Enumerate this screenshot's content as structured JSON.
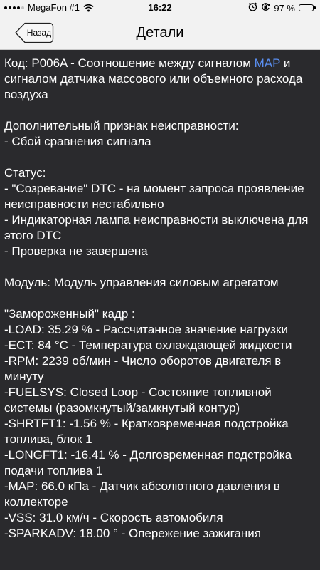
{
  "status_bar": {
    "carrier": "MegaFon #1",
    "time": "16:22",
    "battery_percent": "97 %",
    "battery_level": 0.97,
    "icons": [
      "signal-icon",
      "wifi-icon",
      "alarm-icon",
      "orientation-lock-icon",
      "battery-icon"
    ]
  },
  "nav": {
    "back_label": "Назад",
    "title": "Детали"
  },
  "details": {
    "code_prefix": "Код: P006A - Соотношение между сигналом ",
    "code_link": "MAP",
    "code_suffix": " и сигналом датчика массового или объемного расхода воздуха",
    "extra_heading": "Дополнительный признак неисправности:",
    "extra_item": " - Сбой сравнения сигнала",
    "status_heading": "Статус:",
    "status_item1": " - \"Созревание\" DTC - на момент запроса проявление неисправности нестабильно",
    "status_item2": " - Индикаторная лампа неисправности выключена для этого DTC",
    "status_item3": " - Проверка не завершена",
    "module": "Модуль: Модуль управления силовым агрегатом",
    "freeze_heading": " \"Замороженный\" кадр :",
    "freeze_items": [
      "-LOAD: 35.29 % - Рассчитанное значение нагрузки",
      "-ECT: 84 °C - Температура охлаждающей жидкости",
      "-RPM: 2239 об/мин - Число оборотов двигателя в минуту",
      "-FUELSYS: Closed Loop  - Состояние топливной системы (разомкнутый/замкнутый контур)",
      "-SHRTFT1: -1.56 % - Кратковременная подстройка топлива, блок 1",
      "-LONGFT1: -16.41 % - Долговременная подстройка подачи топлива 1",
      "-MAP: 66.0 кПа - Датчик абсолютного давления в коллекторе",
      "-VSS: 31.0 км/ч - Скорость автомобиля",
      "-SPARKADV: 18.00 ° - Опережение зажигания"
    ]
  },
  "colors": {
    "background": "#2a2a2d",
    "text": "#ffffff",
    "link": "#5a8ef0",
    "bar": "#f2f2f2"
  }
}
